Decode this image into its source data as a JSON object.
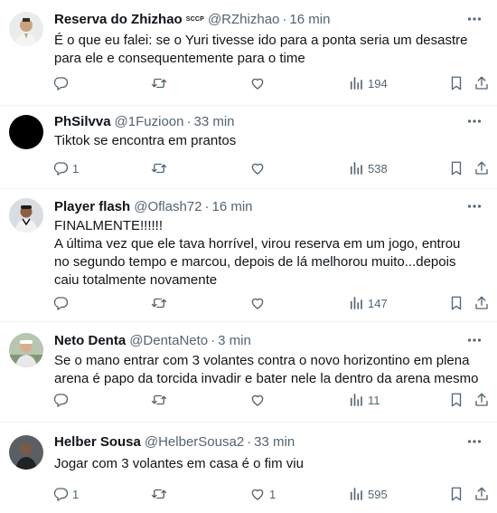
{
  "tweets": [
    {
      "name": "Reserva do Zhizhao",
      "badge": "SCCP",
      "handle": "@RZhizhao",
      "time": "16 min",
      "text": "É o que eu falei: se o Yuri tivesse ido para a ponta seria um desastre para ele e consequentemente para o time",
      "replies": "",
      "likes": "",
      "views": "194",
      "avatar": "man-white-shirt"
    },
    {
      "name": "PhSilvva",
      "badge": "",
      "handle": "@1Fuzioon",
      "time": "33 min",
      "text": "Tiktok se encontra em prantos",
      "replies": "1",
      "likes": "",
      "views": "538",
      "avatar": "black"
    },
    {
      "name": "Player flash",
      "badge": "",
      "handle": "@Oflash72",
      "time": "16 min",
      "text": "FINALMENTE!!!!!!\nA última vez que ele tava horrível, virou reserva em um jogo, entrou no segundo tempo e marcou, depois de lá melhorou muito...depois caiu totalmente novamente",
      "replies": "",
      "likes": "",
      "views": "147",
      "avatar": "player"
    },
    {
      "name": "Neto Denta",
      "badge": "",
      "handle": "@DentaNeto",
      "time": "3 min",
      "text": "Se o mano entrar com 3 volantes contra o novo horizontino em plena arena é papo da torcida invadir e bater nele la dentro da arena mesmo",
      "replies": "",
      "likes": "",
      "views": "11",
      "avatar": "man-outdoor"
    },
    {
      "name": "Helber Sousa",
      "badge": "",
      "handle": "@HelberSousa2",
      "time": "33 min",
      "text": "Jogar com 3 volantes em casa é o fim viu",
      "replies": "1",
      "likes": "1",
      "views": "595",
      "avatar": "man-dark"
    }
  ],
  "icons": {
    "more": "more-icon",
    "reply": "reply-icon",
    "retweet": "retweet-icon",
    "like": "like-icon",
    "views": "views-icon",
    "bookmark": "bookmark-icon",
    "share": "share-icon"
  },
  "colors": {
    "text": "#0f1419",
    "secondary": "#536471",
    "divider": "#eff3f4"
  }
}
